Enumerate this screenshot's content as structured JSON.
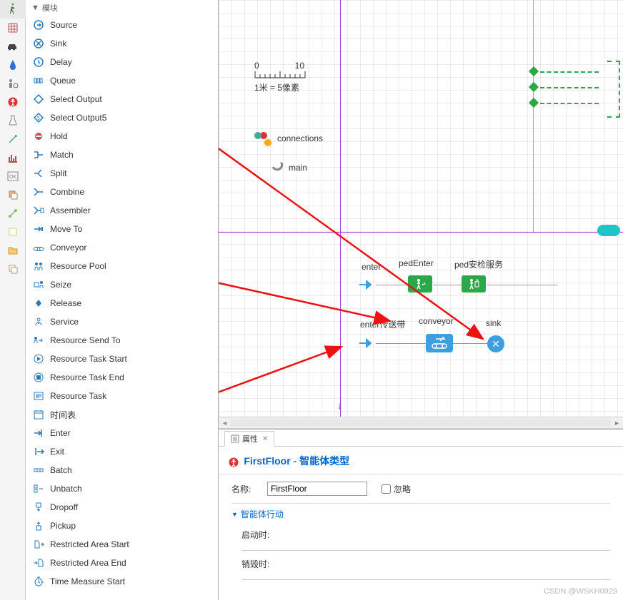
{
  "palette": {
    "group_label": "模块",
    "items": [
      {
        "name": "source",
        "label": "Source"
      },
      {
        "name": "sink",
        "label": "Sink"
      },
      {
        "name": "delay",
        "label": "Delay"
      },
      {
        "name": "queue",
        "label": "Queue"
      },
      {
        "name": "select-output",
        "label": "Select Output"
      },
      {
        "name": "select-output5",
        "label": "Select Output5"
      },
      {
        "name": "hold",
        "label": "Hold"
      },
      {
        "name": "match",
        "label": "Match"
      },
      {
        "name": "split",
        "label": "Split"
      },
      {
        "name": "combine",
        "label": "Combine"
      },
      {
        "name": "assembler",
        "label": "Assembler"
      },
      {
        "name": "move-to",
        "label": "Move To"
      },
      {
        "name": "conveyor",
        "label": "Conveyor"
      },
      {
        "name": "resource-pool",
        "label": "Resource Pool"
      },
      {
        "name": "seize",
        "label": "Seize"
      },
      {
        "name": "release",
        "label": "Release"
      },
      {
        "name": "service",
        "label": "Service"
      },
      {
        "name": "resource-send-to",
        "label": "Resource Send To"
      },
      {
        "name": "resource-task-start",
        "label": "Resource Task Start"
      },
      {
        "name": "resource-task-end",
        "label": "Resource Task End"
      },
      {
        "name": "resource-task",
        "label": "Resource Task"
      },
      {
        "name": "schedule",
        "label": "时间表"
      },
      {
        "name": "enter",
        "label": "Enter"
      },
      {
        "name": "exit",
        "label": "Exit"
      },
      {
        "name": "batch",
        "label": "Batch"
      },
      {
        "name": "unbatch",
        "label": "Unbatch"
      },
      {
        "name": "dropoff",
        "label": "Dropoff"
      },
      {
        "name": "pickup",
        "label": "Pickup"
      },
      {
        "name": "restricted-area-start",
        "label": "Restricted Area Start"
      },
      {
        "name": "restricted-area-end",
        "label": "Restricted Area End"
      },
      {
        "name": "time-measure-start",
        "label": "Time Measure Start"
      }
    ]
  },
  "canvas": {
    "ruler": {
      "start": "0",
      "end": "10",
      "note": "1米 = 5像素"
    },
    "labels": {
      "connections": "connections",
      "main": "main",
      "enter": "enter",
      "pedEnter": "pedEnter",
      "pedSecurity": "ped安检服务",
      "enterConveyor": "enter传送带",
      "conveyor": "conveyor",
      "sink": "sink"
    }
  },
  "properties": {
    "tab_label": "属性",
    "title_prefix": "FirstFloor",
    "title_suffix": " - 智能体类型",
    "name_label": "名称:",
    "name_value": "FirstFloor",
    "ignore_label": "忽略",
    "section1": "智能体行动",
    "startup_label": "启动时:",
    "destroy_label": "销毁时:"
  },
  "watermark": "CSDN @WSKH0929",
  "icon_sidebar": [
    "walk",
    "grid",
    "car",
    "drop",
    "person-cog",
    "accessibility",
    "flask",
    "vector",
    "chart",
    "ok-box",
    "layers",
    "connector",
    "note",
    "folder",
    "copy"
  ]
}
